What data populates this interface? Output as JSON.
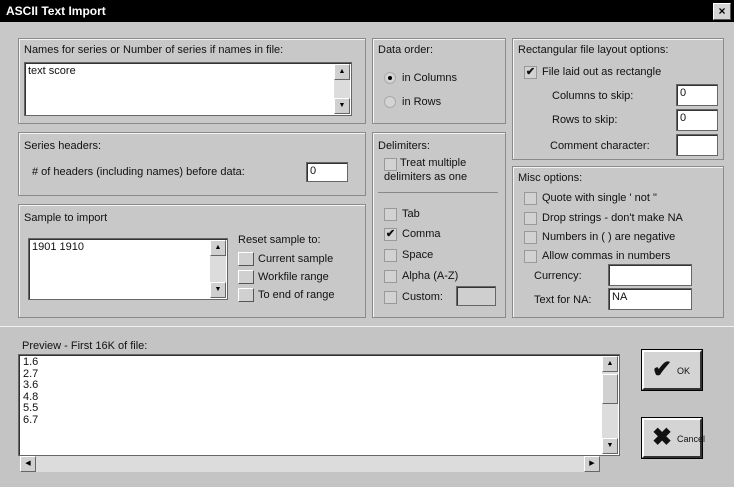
{
  "window": {
    "title": "ASCII Text Import",
    "close_glyph": "×"
  },
  "names": {
    "label": "Names for series or Number of series if names in file:",
    "value": "text score"
  },
  "series_headers": {
    "label": "Series headers:",
    "headers_label": "# of headers (including names) before data:",
    "headers_value": "0"
  },
  "sample": {
    "label": "Sample to import",
    "value": "1901 1910",
    "reset_label": "Reset sample to:",
    "buttons": [
      "Current sample",
      "Workfile range",
      "To end of range"
    ]
  },
  "data_order": {
    "label": "Data order:",
    "options": [
      {
        "label": "in Columns",
        "selected": true
      },
      {
        "label": "in Rows",
        "selected": false
      }
    ]
  },
  "delimiters": {
    "label": "Delimiters:",
    "treat_multiple": "Treat multiple delimiters as one",
    "treat_multiple_line1": "Treat multiple",
    "treat_multiple_line2": "delimiters as one",
    "treat_multiple_checked": false,
    "items": [
      {
        "label": "Tab",
        "checked": false
      },
      {
        "label": "Comma",
        "checked": true
      },
      {
        "label": "Space",
        "checked": false
      },
      {
        "label": "Alpha (A-Z)",
        "checked": false
      },
      {
        "label": "Custom:",
        "checked": false
      }
    ],
    "custom_value": ""
  },
  "rect_layout": {
    "label": "Rectangular file layout options:",
    "file_laid_out": "File laid out as rectangle",
    "file_laid_out_checked": true,
    "columns_to_skip_label": "Columns to skip:",
    "columns_to_skip_value": "0",
    "rows_to_skip_label": "Rows to skip:",
    "rows_to_skip_value": "0",
    "comment_char_label": "Comment character:",
    "comment_char_value": ""
  },
  "misc": {
    "label": "Misc options:",
    "options": [
      {
        "label": "Quote with single ' not \"",
        "checked": false
      },
      {
        "label": "Drop strings - don't make NA",
        "checked": false
      },
      {
        "label": "Numbers in ( ) are negative",
        "checked": false
      },
      {
        "label": "Allow commas in numbers",
        "checked": false
      }
    ],
    "currency_label": "Currency:",
    "currency_value": "",
    "text_for_na_label": "Text for NA:",
    "text_for_na_value": "NA"
  },
  "preview": {
    "label": "Preview - First 16K of file:",
    "lines": [
      "1.6",
      "2.7",
      "3.6",
      "4.8",
      "5.5",
      "6.7"
    ]
  },
  "actions": {
    "ok_label": "OK",
    "cancel_label": "Cancel",
    "ok_icon": "checkmark-icon",
    "cancel_icon": "x-mark-icon"
  }
}
